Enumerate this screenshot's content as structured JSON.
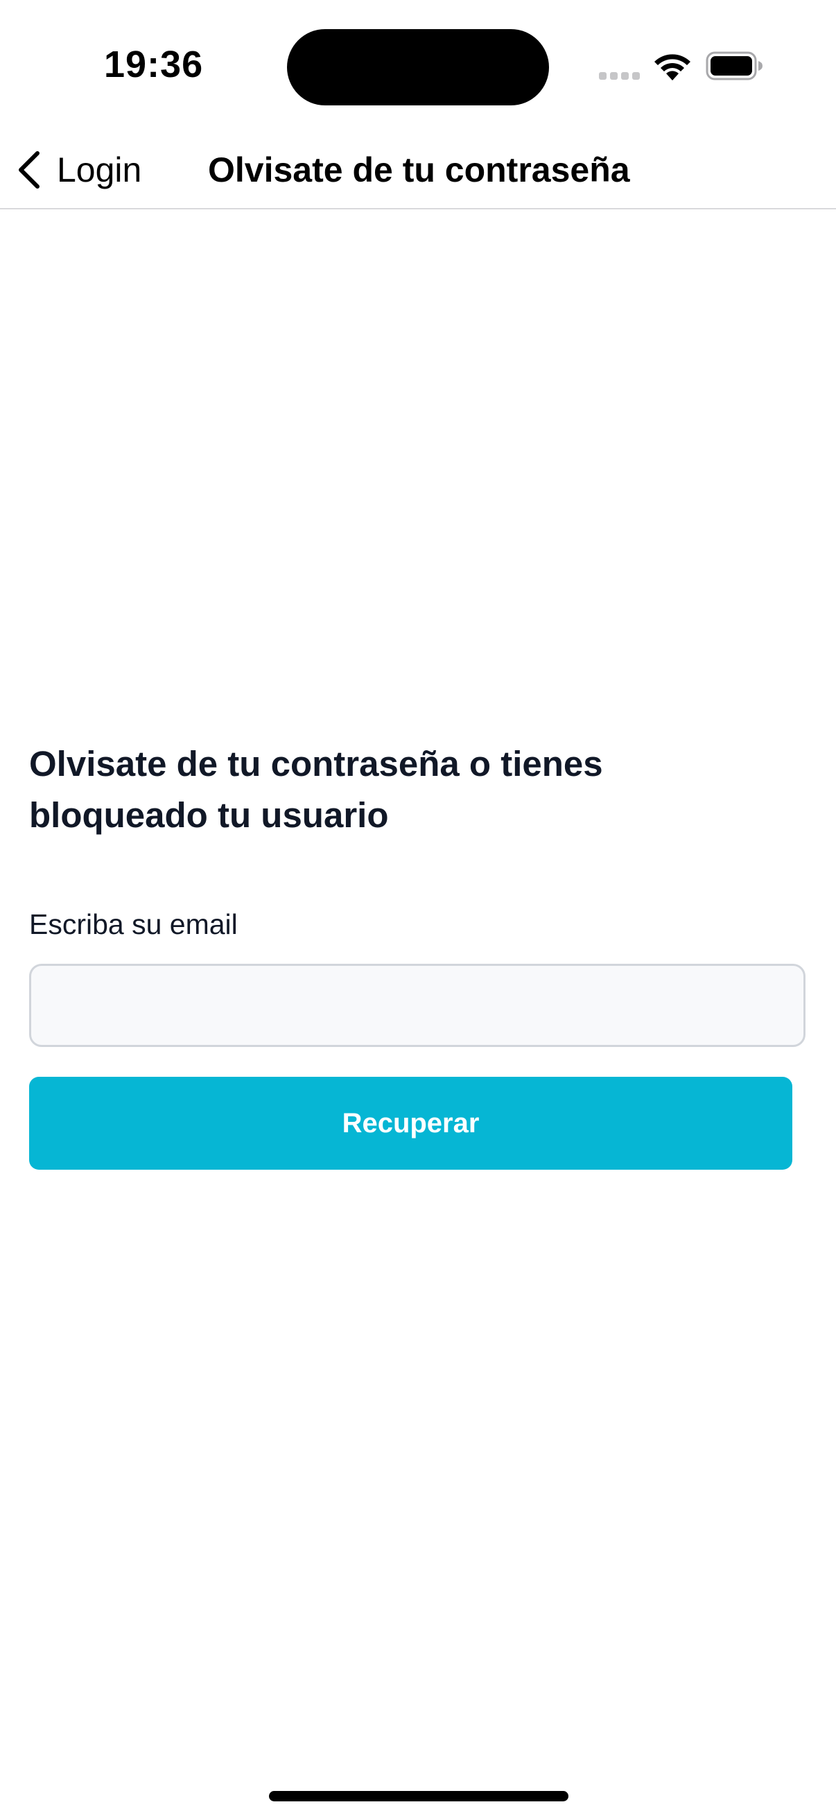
{
  "status_bar": {
    "time": "19:36",
    "icons": [
      "cellular-signal-icon",
      "wifi-icon",
      "battery-icon"
    ]
  },
  "nav": {
    "back_label": "Login",
    "title": "Olvisate de tu contraseña"
  },
  "form": {
    "heading": "Olvisate de tu contraseña o tienes bloqueado tu usuario",
    "email_label": "Escriba su email",
    "email_value": "",
    "email_placeholder": "",
    "submit_label": "Recuperar"
  },
  "colors": {
    "accent": "#06b6d4",
    "input_background": "#f8f9fb",
    "input_border": "#d1d5db",
    "text": "#111827"
  }
}
